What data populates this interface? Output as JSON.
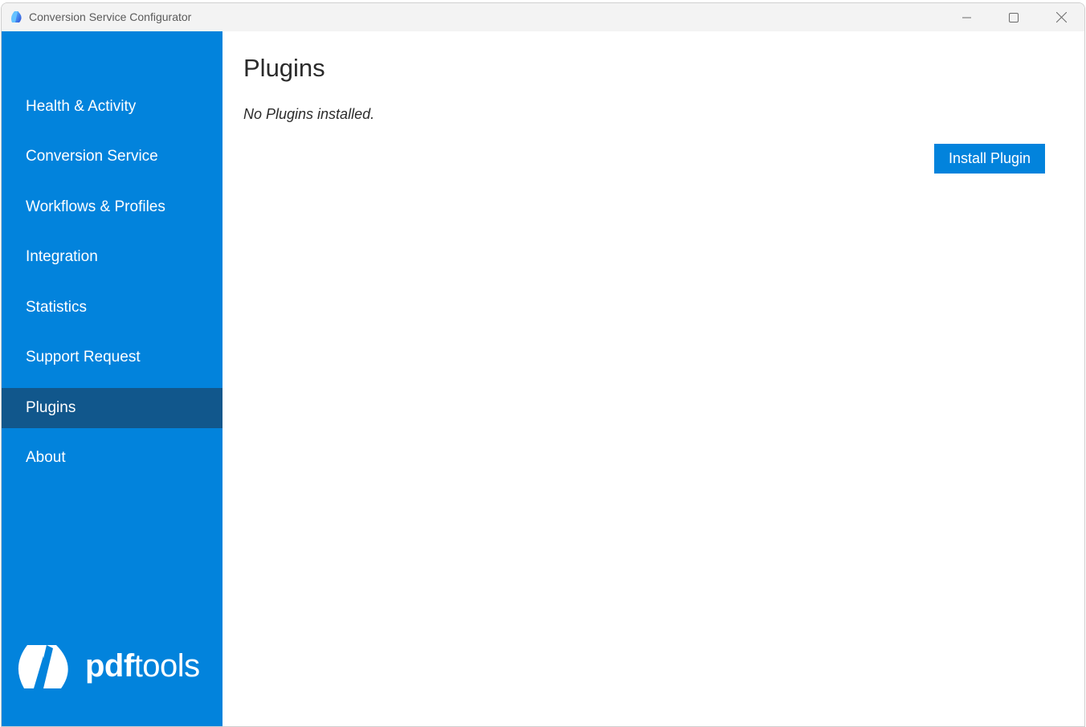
{
  "window": {
    "title": "Conversion Service Configurator",
    "controls": {
      "minimize": "minimize-icon",
      "maximize": "maximize-icon",
      "close": "close-icon"
    }
  },
  "sidebar": {
    "items": [
      {
        "label": "Health & Activity",
        "active": false
      },
      {
        "label": "Conversion Service",
        "active": false
      },
      {
        "label": "Workflows & Profiles",
        "active": false
      },
      {
        "label": "Integration",
        "active": false
      },
      {
        "label": "Statistics",
        "active": false
      },
      {
        "label": "Support Request",
        "active": false
      },
      {
        "label": "Plugins",
        "active": true
      },
      {
        "label": "About",
        "active": false
      }
    ],
    "logo": {
      "bold": "pdf",
      "regular": "tools"
    }
  },
  "main": {
    "title": "Plugins",
    "empty_message": "No Plugins installed.",
    "install_button": "Install Plugin"
  },
  "colors": {
    "accent": "#0283dc",
    "active_nav": "#11578c"
  }
}
